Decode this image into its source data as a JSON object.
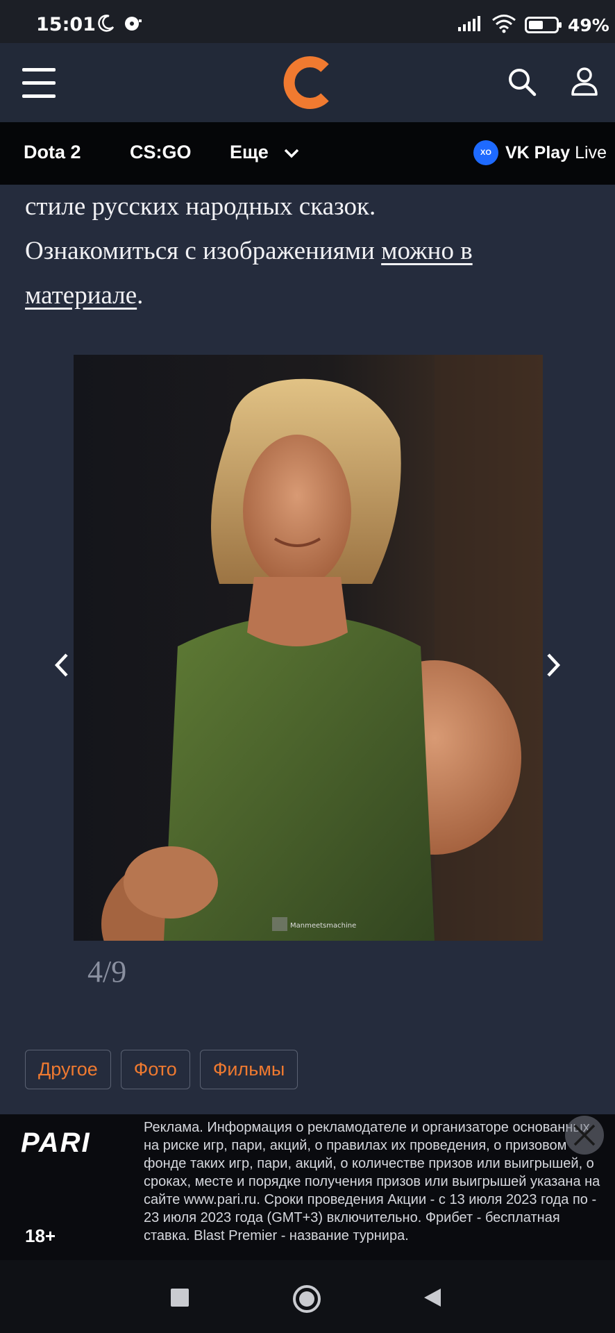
{
  "status_bar": {
    "time": "15:01",
    "battery": "49%"
  },
  "header": {
    "logo_icon": "cybersport-logo",
    "menu_icon": "hamburger-menu-icon",
    "search_icon": "search-icon",
    "profile_icon": "user-icon"
  },
  "category_nav": {
    "items": [
      {
        "label": "Dota 2"
      },
      {
        "label": "CS:GO"
      },
      {
        "label": "Еще"
      }
    ],
    "partner": {
      "badge": "XO",
      "label": "VK Play",
      "label_suffix": "Live"
    }
  },
  "article": {
    "line1": "стиле русских народных сказок.",
    "line2": "Ознакомиться с изображениями ",
    "link": "можно в материале",
    "end": "."
  },
  "gallery": {
    "current": "4/9",
    "watermark": "Manmeetsmachine"
  },
  "tags": [
    {
      "label": "Другое"
    },
    {
      "label": "Фото"
    },
    {
      "label": "Фильмы"
    }
  ],
  "ad": {
    "brand": "PARI",
    "age": "18+",
    "text": "Реклама. Информация о рекламодателе и организаторе основанных на риске игр, пари, акций, о правилах их проведения, о призовом фонде таких игр, пари, акций, о количестве призов или выигрышей, о сроках, месте и порядке получения призов или выигрышей указана на сайте www.pari.ru. Сроки проведения Акции - с 13 июля 2023 года по - 23 июля 2023 года (GMT+3) включительно. Фрибет - бесплатная ставка. Blast Premier - название турнира."
  },
  "colors": {
    "accent": "#f07a30",
    "background": "#252c3d",
    "nav_bg": "#050608"
  }
}
